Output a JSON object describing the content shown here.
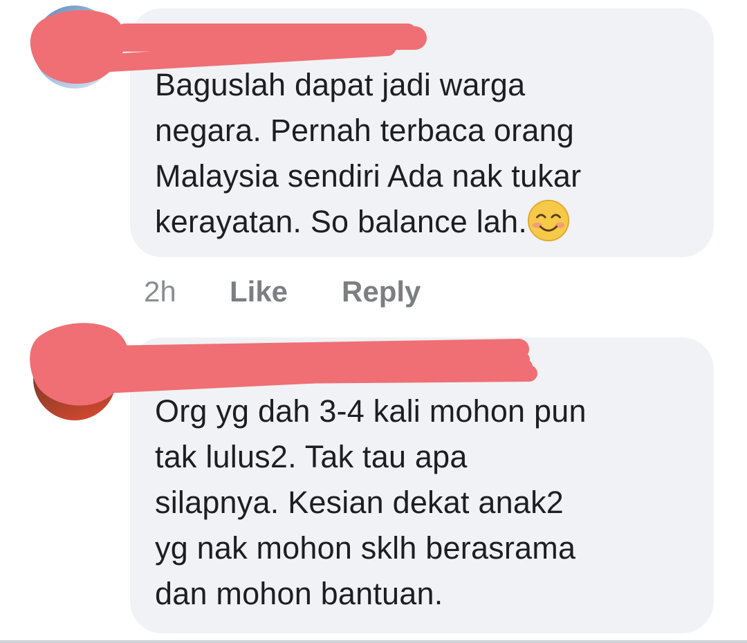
{
  "comments": [
    {
      "author": "",
      "text": "Baguslah dapat jadi warga\nnegara. Pernah terbaca orang\nMalaysia sendiri Ada nak tukar\nkerayatan. So balance lah.",
      "emoji": "smiling-face-icon",
      "time": "2h",
      "like_label": "Like",
      "reply_label": "Reply"
    },
    {
      "author": "",
      "text": "Org yg dah 3-4 kali mohon pun\ntak lulus2. Tak tau apa\nsilapnya. Kesian dekat anak2\nyg nak mohon sklh berasrama\ndan mohon bantuan."
    }
  ],
  "colors": {
    "bubble": "#f0f2f5",
    "redaction": "#ef6f74",
    "text": "#1c1e21",
    "meta": "#65676b"
  }
}
